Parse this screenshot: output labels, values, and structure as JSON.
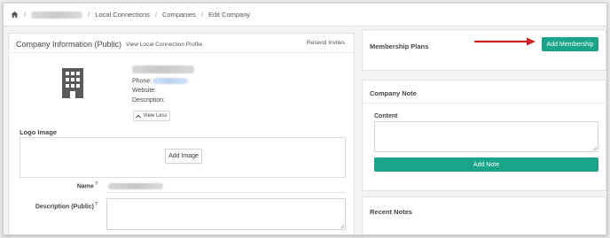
{
  "breadcrumb": {
    "items": [
      "Local Connections",
      "Companies",
      "Edit Company"
    ],
    "separator": "/"
  },
  "company_info": {
    "title": "Company Information (Public)",
    "view_profile_link": "View Local Connection Profile",
    "resend_invites": "Resend Invites",
    "phone_label": "Phone:",
    "website_label": "Website:",
    "description_label": "Description:",
    "view_less_label": "View Less",
    "logo_image_label": "Logo Image",
    "add_image_label": "Add Image",
    "name_label": "Name",
    "description_public_label": "Description (Public)",
    "help_mark": "?"
  },
  "membership_plans": {
    "title": "Membership Plans",
    "add_button_label": "Add Membership"
  },
  "company_note": {
    "title": "Company Note",
    "content_label": "Content",
    "add_note_label": "Add Note"
  },
  "recent_notes": {
    "title": "Recent Notes"
  },
  "colors": {
    "accent": "#1aa58b",
    "arrow": "#d62020"
  },
  "icons": [
    "home-icon",
    "building-icon",
    "chevron-up-icon",
    "red-arrow-annotation"
  ]
}
